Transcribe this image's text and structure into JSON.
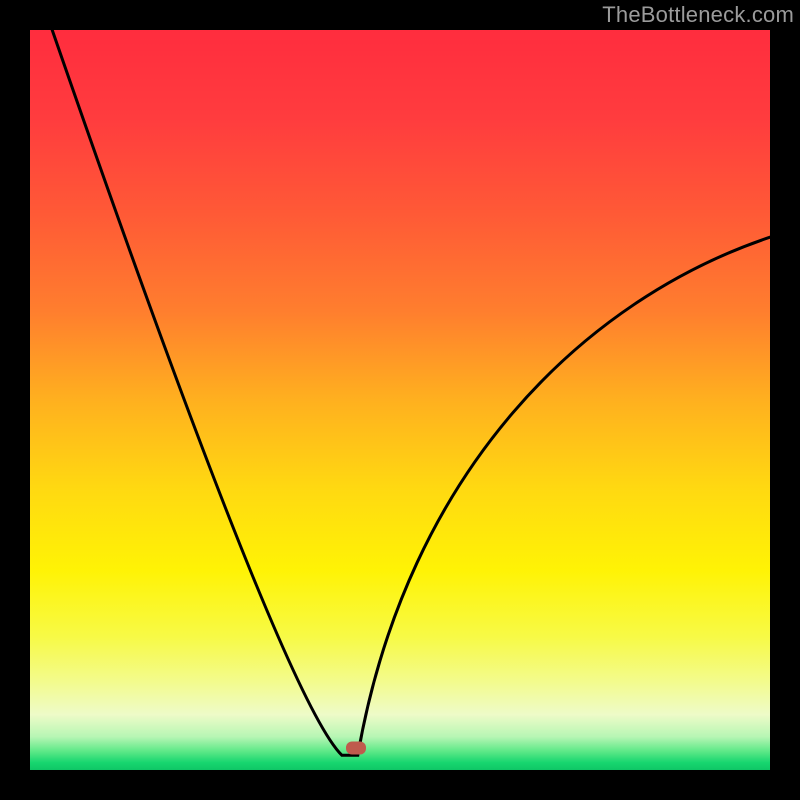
{
  "watermark": "TheBottleneck.com",
  "chart_data": {
    "type": "line",
    "title": "",
    "xlabel": "",
    "ylabel": "",
    "xlim": [
      0,
      100
    ],
    "ylim": [
      0,
      100
    ],
    "grid": false,
    "legend": false,
    "curve": {
      "start_x": 3,
      "start_y": 100,
      "dip_x": 43,
      "dip_y": 2,
      "end_x": 100,
      "end_y": 72
    },
    "marker": {
      "x": 44,
      "y": 3,
      "color": "#bf5a4d"
    },
    "background_gradient": {
      "stops": [
        {
          "offset": 0.0,
          "color": "#ff2d3e"
        },
        {
          "offset": 0.12,
          "color": "#ff3c3e"
        },
        {
          "offset": 0.25,
          "color": "#ff5a36"
        },
        {
          "offset": 0.38,
          "color": "#ff7e2e"
        },
        {
          "offset": 0.5,
          "color": "#ffb01f"
        },
        {
          "offset": 0.62,
          "color": "#ffd911"
        },
        {
          "offset": 0.73,
          "color": "#fff305"
        },
        {
          "offset": 0.82,
          "color": "#f7fa46"
        },
        {
          "offset": 0.88,
          "color": "#f3fb8c"
        },
        {
          "offset": 0.925,
          "color": "#eefbc8"
        },
        {
          "offset": 0.955,
          "color": "#b7f6b4"
        },
        {
          "offset": 0.975,
          "color": "#5ce887"
        },
        {
          "offset": 0.99,
          "color": "#17d66f"
        },
        {
          "offset": 1.0,
          "color": "#0fc666"
        }
      ]
    }
  }
}
